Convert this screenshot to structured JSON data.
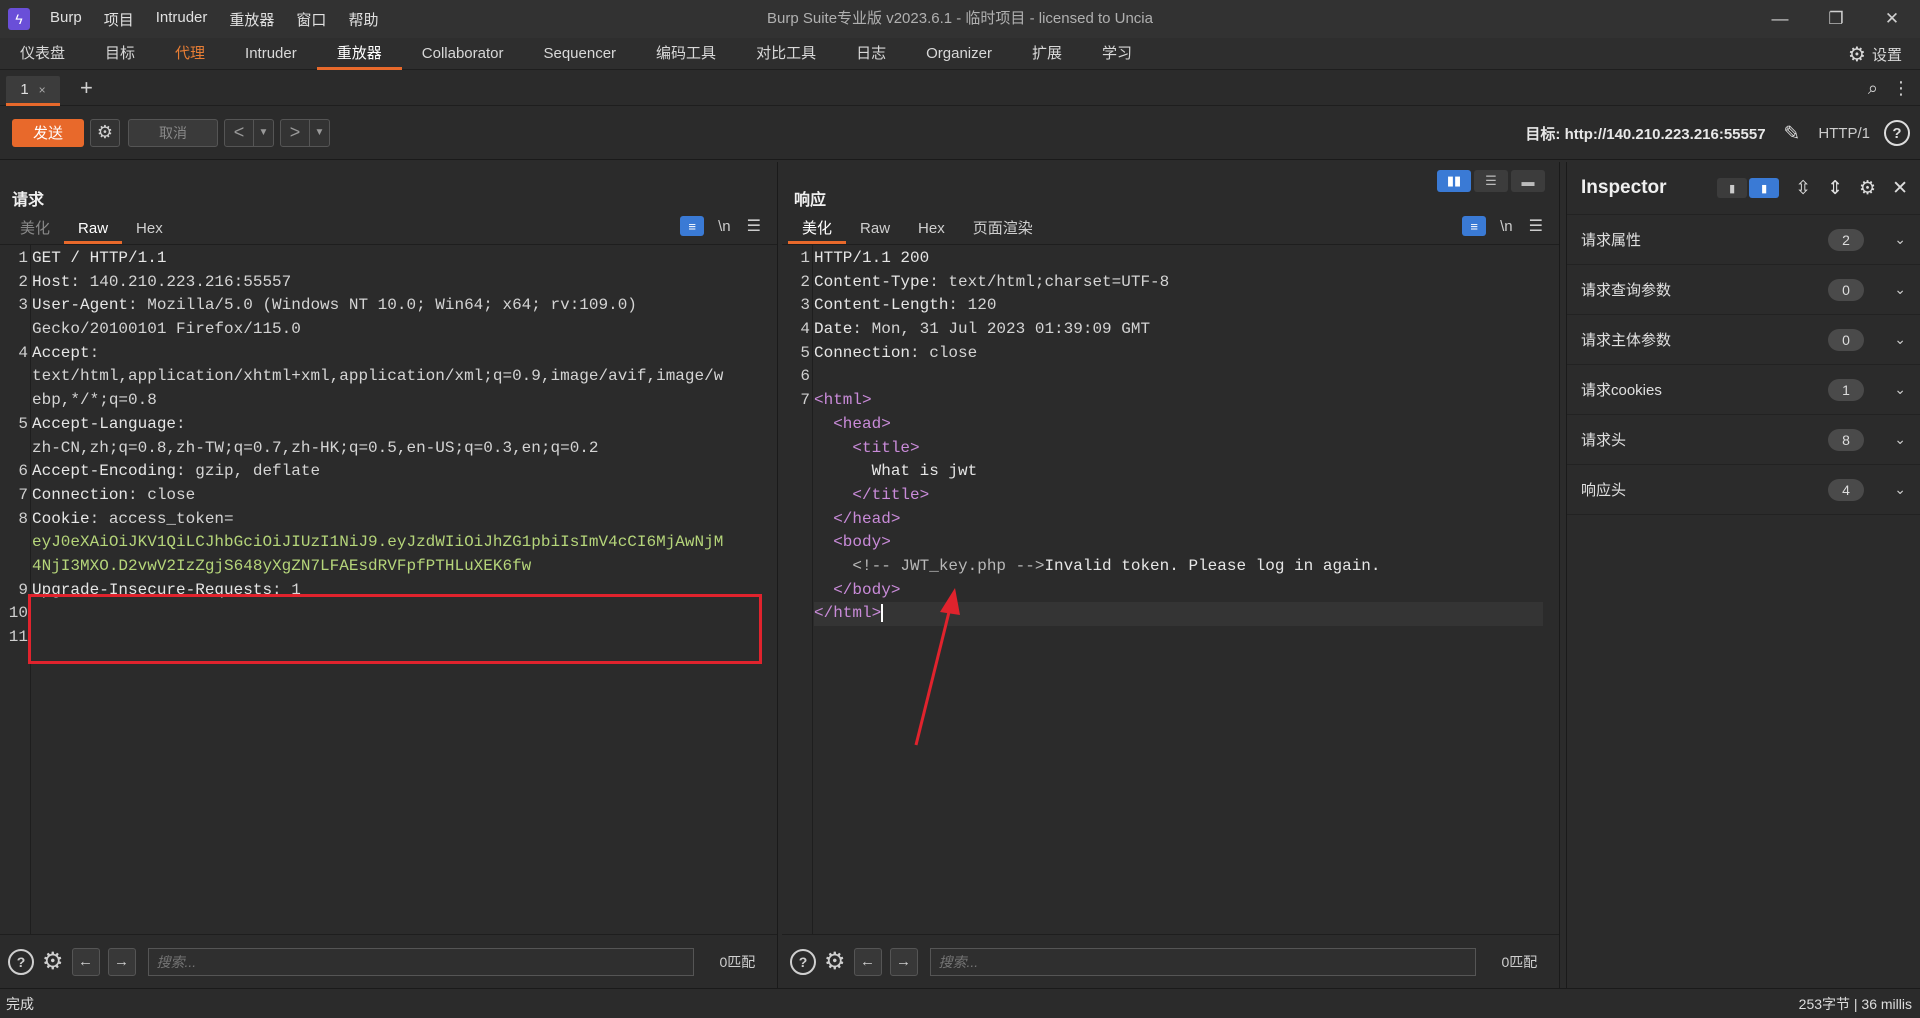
{
  "titlebar": {
    "app_name": "Burp",
    "menu": [
      "Burp",
      "项目",
      "Intruder",
      "重放器",
      "窗口",
      "帮助"
    ],
    "window_title": "Burp Suite专业版  v2023.6.1 - 临时项目 - licensed to Uncia"
  },
  "main_tabs": [
    "仪表盘",
    "目标",
    "代理",
    "Intruder",
    "重放器",
    "Collaborator",
    "Sequencer",
    "编码工具",
    "对比工具",
    "日志",
    "Organizer",
    "扩展",
    "学习"
  ],
  "active_main_tab": "重放器",
  "settings_label": "设置",
  "repeater_tab": {
    "label": "1",
    "close": "×"
  },
  "toolbar": {
    "send_label": "发送",
    "cancel_label": "取消",
    "target_label": "目标: http://140.210.223.216:55557",
    "protocol": "HTTP/1"
  },
  "request": {
    "title": "请求",
    "tabs": [
      "美化",
      "Raw",
      "Hex"
    ],
    "active_tab": "Raw",
    "lines": [
      {
        "n": "1",
        "k": "GET / HTTP/1.1",
        "v": ""
      },
      {
        "n": "2",
        "k": "Host",
        "v": ": 140.210.223.216:55557"
      },
      {
        "n": "3",
        "k": "User-Agent",
        "v": ": Mozilla/5.0 (Windows NT 10.0; Win64; x64; rv:109.0)"
      },
      {
        "n": "",
        "k": "",
        "v": "Gecko/20100101 Firefox/115.0"
      },
      {
        "n": "4",
        "k": "Accept",
        "v": ":"
      },
      {
        "n": "",
        "k": "",
        "v": "text/html,application/xhtml+xml,application/xml;q=0.9,image/avif,image/w"
      },
      {
        "n": "",
        "k": "",
        "v": "ebp,*/*;q=0.8"
      },
      {
        "n": "5",
        "k": "Accept-Language",
        "v": ":"
      },
      {
        "n": "",
        "k": "",
        "v": "zh-CN,zh;q=0.8,zh-TW;q=0.7,zh-HK;q=0.5,en-US;q=0.3,en;q=0.2"
      },
      {
        "n": "6",
        "k": "Accept-Encoding",
        "v": ": gzip, deflate"
      },
      {
        "n": "7",
        "k": "Connection",
        "v": ": close"
      },
      {
        "n": "8",
        "k": "Cookie",
        "v": ": access_token="
      },
      {
        "n": "",
        "k": "",
        "tok": "eyJ0eXAiOiJKV1QiLCJhbGciOiJIUzI1NiJ9.eyJzdWIiOiJhZG1pbiIsImV4cCI6MjAwNjM"
      },
      {
        "n": "",
        "k": "",
        "tok": "4NjI3MXO.D2vwV2IzZgjS648yXgZN7LFAEsdRVFpfPTHLuXEK6fw"
      },
      {
        "n": "9",
        "k": "Upgrade-Insecure-Requests",
        "v": ": 1"
      },
      {
        "n": "10",
        "k": "",
        "v": ""
      },
      {
        "n": "11",
        "k": "",
        "v": ""
      }
    ],
    "search_placeholder": "搜索...",
    "match_count": "0匹配"
  },
  "response": {
    "title": "响应",
    "tabs": [
      "美化",
      "Raw",
      "Hex",
      "页面渲染"
    ],
    "active_tab": "美化",
    "lines": [
      {
        "n": "1",
        "html": "<span class='k'>HTTP/1.1 200</span>"
      },
      {
        "n": "2",
        "html": "<span class='k'>Content-Type</span><span class='v'>: text/html;charset=UTF-8</span>"
      },
      {
        "n": "3",
        "html": "<span class='k'>Content-Length</span><span class='v'>: 120</span>"
      },
      {
        "n": "4",
        "html": "<span class='k'>Date</span><span class='v'>: Mon, 31 Jul 2023 01:39:09 GMT</span>"
      },
      {
        "n": "5",
        "html": "<span class='k'>Connection</span><span class='v'>: close</span>"
      },
      {
        "n": "6",
        "html": ""
      },
      {
        "n": "7",
        "html": "<span class='tag'>&lt;html&gt;</span>"
      },
      {
        "n": "",
        "html": "  <span class='tag'>&lt;head&gt;</span>"
      },
      {
        "n": "",
        "html": "    <span class='tag'>&lt;title&gt;</span>"
      },
      {
        "n": "",
        "html": "      What is jwt"
      },
      {
        "n": "",
        "html": "    <span class='tag'>&lt;/title&gt;</span>"
      },
      {
        "n": "",
        "html": "  <span class='tag'>&lt;/head&gt;</span>"
      },
      {
        "n": "",
        "html": "  <span class='tag'>&lt;body&gt;</span>"
      },
      {
        "n": "",
        "html": "    <span class='cmt'>&lt;!-- JWT_key.php --&gt;</span>Invalid token. Please log in again."
      },
      {
        "n": "",
        "html": "  <span class='tag'>&lt;/body&gt;</span>"
      },
      {
        "n": "",
        "html": "<span class='tag'>&lt;/html&gt;</span><span class='caret'></span>"
      }
    ],
    "search_placeholder": "搜索...",
    "match_count": "0匹配"
  },
  "inspector": {
    "title": "Inspector",
    "rows": [
      {
        "label": "请求属性",
        "count": "2"
      },
      {
        "label": "请求查询参数",
        "count": "0"
      },
      {
        "label": "请求主体参数",
        "count": "0"
      },
      {
        "label": "请求cookies",
        "count": "1"
      },
      {
        "label": "请求头",
        "count": "8"
      },
      {
        "label": "响应头",
        "count": "4"
      }
    ]
  },
  "status": {
    "left": "完成",
    "right": "253字节 | 36 millis"
  },
  "colors": {
    "accent": "#e8692b",
    "highlight_box": "#e0232d",
    "toggle_blue": "#3a7ad5"
  }
}
